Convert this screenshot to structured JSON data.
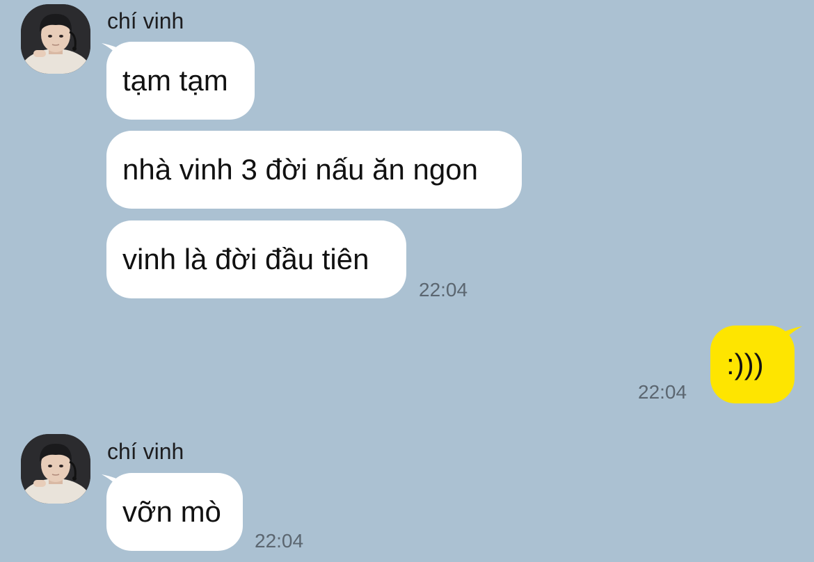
{
  "colors": {
    "background": "#abc1d2",
    "incoming_bubble": "#ffffff",
    "outgoing_bubble": "#fee500",
    "timestamp_text": "#5b6670"
  },
  "messages": [
    {
      "sender": "chí vinh",
      "avatar_icon": "user-avatar-photo",
      "bubbles": [
        "tạm tạm",
        "nhà vinh 3 đời nấu ăn ngon",
        "vinh là đời đầu tiên"
      ],
      "time": "22:04"
    },
    {
      "sender": "me",
      "bubbles": [
        ":)))"
      ],
      "time": "22:04"
    },
    {
      "sender": "chí vinh",
      "avatar_icon": "user-avatar-photo",
      "bubbles": [
        "vỡn mò"
      ],
      "time": "22:04"
    }
  ]
}
